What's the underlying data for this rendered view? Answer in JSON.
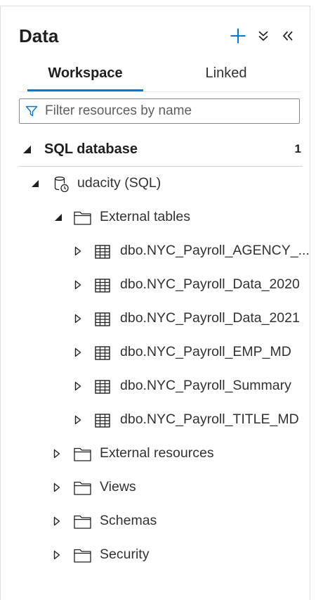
{
  "header": {
    "title": "Data",
    "add_icon": "plus-icon",
    "expand_icon": "double-chevron-down-icon",
    "collapse_icon": "double-chevron-left-icon"
  },
  "tabs": [
    {
      "label": "Workspace",
      "active": true
    },
    {
      "label": "Linked",
      "active": false
    }
  ],
  "filter": {
    "placeholder": "Filter resources by name",
    "value": ""
  },
  "section": {
    "label": "SQL database",
    "count": "1",
    "expanded": true
  },
  "tree": {
    "database": {
      "label": "udacity (SQL)",
      "expanded": true
    },
    "external_tables": {
      "label": "External tables",
      "expanded": true,
      "tables": [
        "dbo.NYC_Payroll_AGENCY_...",
        "dbo.NYC_Payroll_Data_2020",
        "dbo.NYC_Payroll_Data_2021",
        "dbo.NYC_Payroll_EMP_MD",
        "dbo.NYC_Payroll_Summary",
        "dbo.NYC_Payroll_TITLE_MD"
      ]
    },
    "folders": [
      "External resources",
      "Views",
      "Schemas",
      "Security"
    ]
  },
  "colors": {
    "accent": "#0078d4",
    "text": "#323130"
  }
}
